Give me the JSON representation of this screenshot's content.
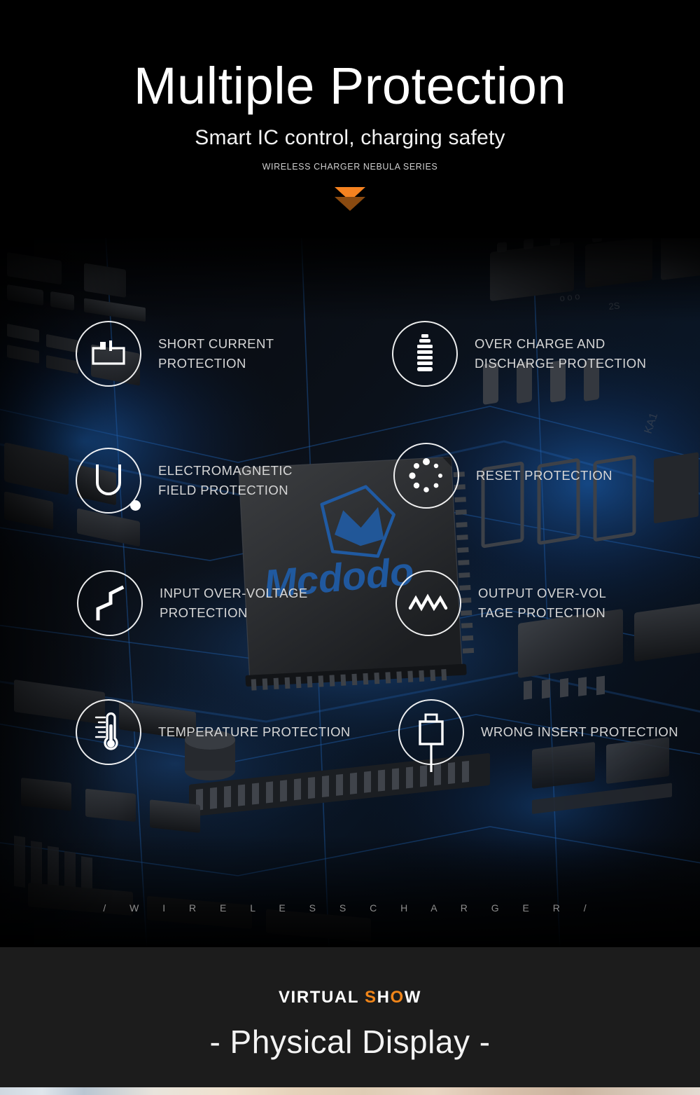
{
  "hero": {
    "title": "Multiple Protection",
    "subtitle": "Smart IC control, charging safety",
    "series": "WIRELESS CHARGER NEBULA SERIES",
    "scroll_hint_icon": "double-chevron-down-icon"
  },
  "features": [
    {
      "id": "short-current",
      "icon": "short-circuit-icon",
      "label": "SHORT CURRENT\nPROTECTION"
    },
    {
      "id": "over-charge",
      "icon": "battery-icon",
      "label": "OVER CHARGE AND\nDISCHARGE PROTECTION"
    },
    {
      "id": "electromagnetic",
      "icon": "magnet-u-icon",
      "label": "ELECTROMAGNETIC\nFIELD PROTECTION"
    },
    {
      "id": "reset",
      "icon": "spinner-dots-icon",
      "label": "RESET PROTECTION"
    },
    {
      "id": "input-over-voltage",
      "icon": "square-wave-icon",
      "label": "INPUT OVER-VOLTAGE\nPROTECTION"
    },
    {
      "id": "output-over-voltage",
      "icon": "zigzag-wave-icon",
      "label": "OUTPUT OVER-VOL\nTAGE PROTECTION"
    },
    {
      "id": "temperature",
      "icon": "thermometer-icon",
      "label": "TEMPERATURE PROTECTION"
    },
    {
      "id": "wrong-insert",
      "icon": "plug-connector-icon",
      "label": "WRONG INSERT PROTECTION"
    }
  ],
  "board": {
    "chip_brand": "Mcdodo",
    "watermark": "/ W I R E L E S S   C H A R G E R /"
  },
  "bottom": {
    "eyebrow_parts": [
      {
        "text": "VIRTUAL ",
        "accent": false
      },
      {
        "text": "S",
        "accent": true
      },
      {
        "text": "H",
        "accent": false
      },
      {
        "text": "O",
        "accent": true
      },
      {
        "text": "W",
        "accent": false
      }
    ],
    "eyebrow_plain": "VIRTUAL SHOW",
    "headline": "- Physical Display -"
  },
  "colors": {
    "accent_orange": "#f08519",
    "chevron_bright": "#f58220",
    "chevron_dim": "#8a4a10",
    "background_black": "#000000",
    "panel_gray": "#1c1c1c",
    "icon_white": "#ffffff",
    "label_gray": "#d6d6d6",
    "circuit_blue": "#1f5fae"
  }
}
